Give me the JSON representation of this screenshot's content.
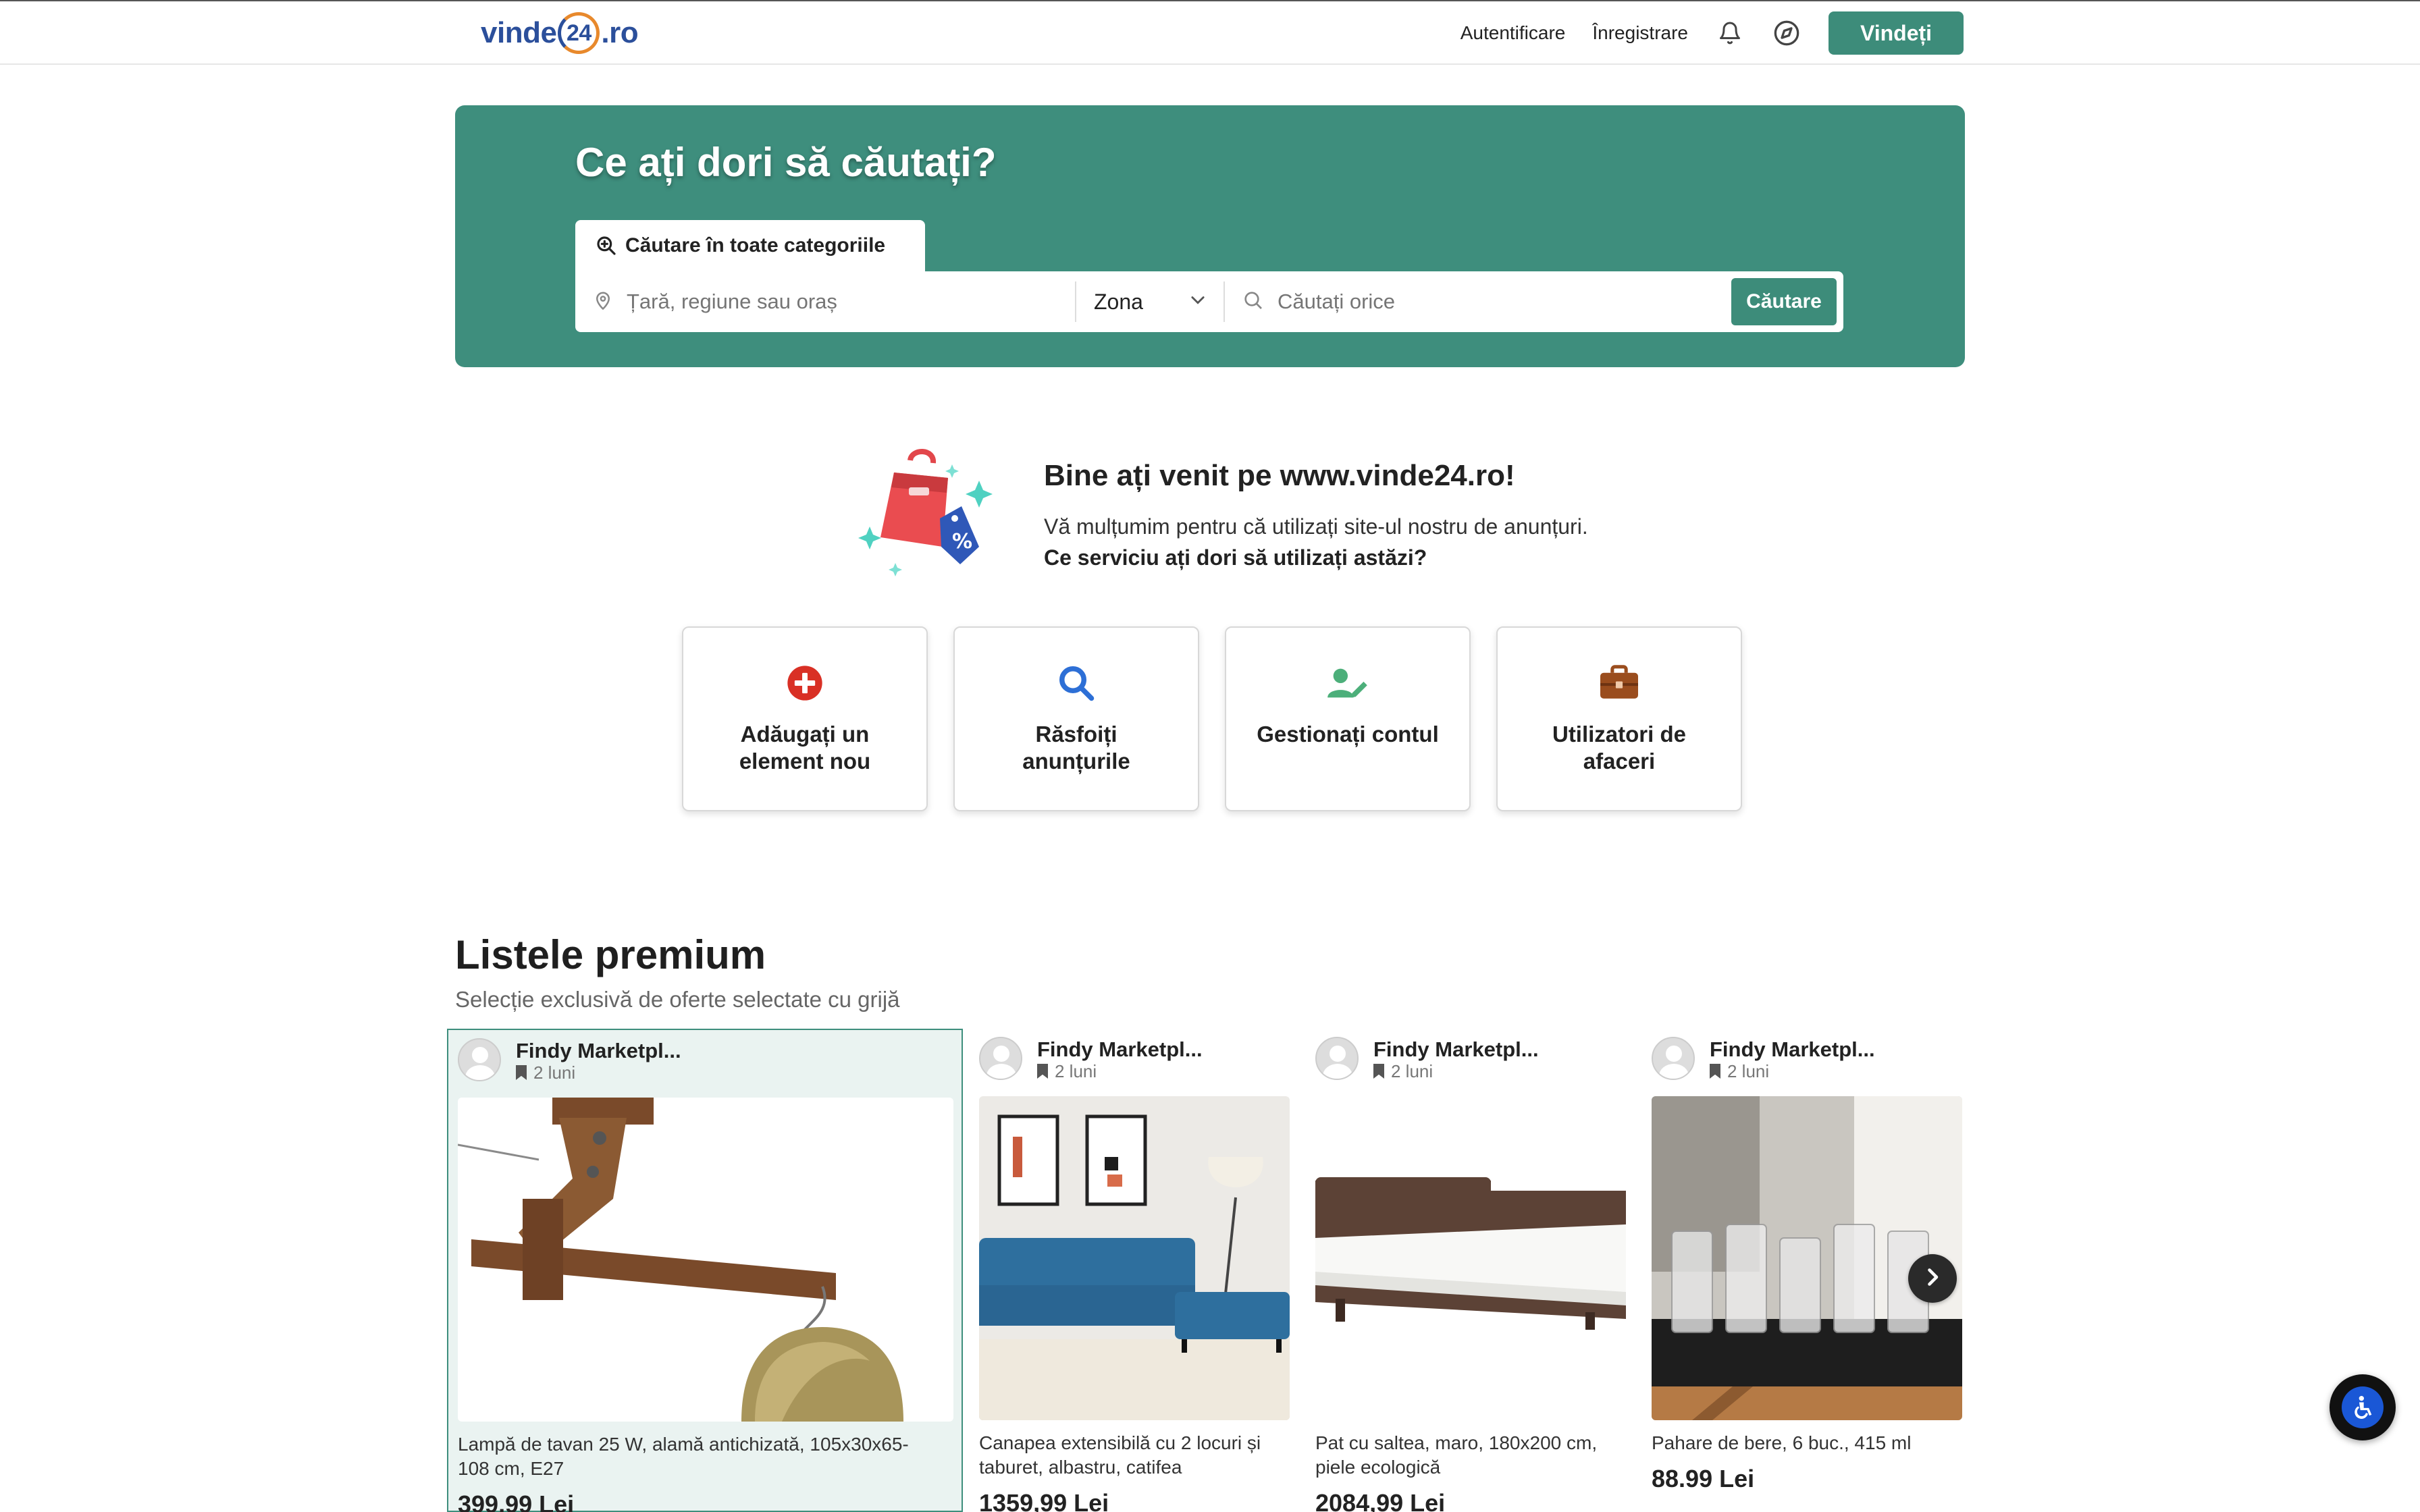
{
  "header": {
    "logo_prefix": "vinde",
    "logo_badge": "24",
    "logo_suffix": ".ro",
    "login_label": "Autentificare",
    "register_label": "Înregistrare",
    "sell_label": "Vindeți",
    "icons": [
      "bell-icon",
      "compass-icon"
    ]
  },
  "hero": {
    "title": "Ce ați dori să căutați?",
    "tab_label": "Căutare în toate categoriile",
    "location_placeholder": "Țară, regiune sau oraș",
    "zone_label": "Zona",
    "query_placeholder": "Căutați orice",
    "search_button": "Căutare",
    "accent": "#3e8e7d"
  },
  "welcome": {
    "title": "Bine ați venit pe www.vinde24.ro!",
    "text": "Vă mulțumim pentru că utilizați site-ul nostru de anunțuri.",
    "question": "Ce serviciu ați dori să utilizați astăzi?"
  },
  "services": [
    {
      "label": "Adăugați un element nou",
      "icon": "plus-circle-icon",
      "color": "#d93025"
    },
    {
      "label": "Răsfoiți anunțurile",
      "icon": "magnifier-icon",
      "color": "#2d6fd6"
    },
    {
      "label": "Gestionați contul",
      "icon": "user-edit-icon",
      "color": "#4caf7a"
    },
    {
      "label": "Utilizatori de afaceri",
      "icon": "briefcase-icon",
      "color": "#9a4d1e"
    }
  ],
  "premium": {
    "title": "Listele premium",
    "subtitle": "Selecție exclusivă de oferte selectate cu grijă",
    "listings": [
      {
        "seller": "Findy Marketpl...",
        "age": "2 luni",
        "title_line1": "Lampă de tavan 25 W, alamă antichizată, 105x30x65-",
        "title_line2": "108 cm, E27",
        "price": "399,99 Lei",
        "image": "ceiling-lamp-photo"
      },
      {
        "seller": "Findy Marketpl...",
        "age": "2 luni",
        "title_line1": "Canapea extensibilă cu 2 locuri și",
        "title_line2": "taburet, albastru, catifea",
        "price": "1359,99 Lei",
        "image": "sofa-photo"
      },
      {
        "seller": "Findy Marketpl...",
        "age": "2 luni",
        "title_line1": "Pat cu saltea, maro, 180x200 cm,",
        "title_line2": "piele ecologică",
        "price": "2084,99 Lei",
        "image": "bed-photo"
      },
      {
        "seller": "Findy Marketpl...",
        "age": "2 luni",
        "title_line1": "Pahare de bere, 6 buc., 415 ml",
        "title_line2": "",
        "price": "88.99 Lei",
        "image": "beer-glasses-photo"
      }
    ]
  }
}
